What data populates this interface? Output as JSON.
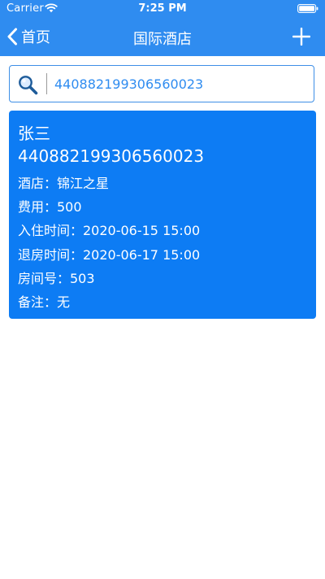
{
  "status_bar": {
    "carrier": "Carrier",
    "time": "7:25 PM",
    "wifi_icon": "wifi-icon",
    "battery_icon": "battery-icon"
  },
  "nav": {
    "back_label": "首页",
    "title": "国际酒店",
    "back_icon": "chevron-left-icon",
    "add_icon": "plus-icon"
  },
  "search": {
    "value": "440882199306560023",
    "icon": "search-icon"
  },
  "record": {
    "name": "张三",
    "id_number": "440882199306560023",
    "hotel": "酒店：锦江之星",
    "cost": "费用：500",
    "check_in": "入住时间：2020-06-15 15:00",
    "check_out": "退房时间：2020-06-17 15:00",
    "room": "房间号：503",
    "note": "备注：无"
  },
  "colors": {
    "nav_background": "#2f8cf0",
    "card_background": "#0d7cf4",
    "accent": "#3e8fe6"
  }
}
